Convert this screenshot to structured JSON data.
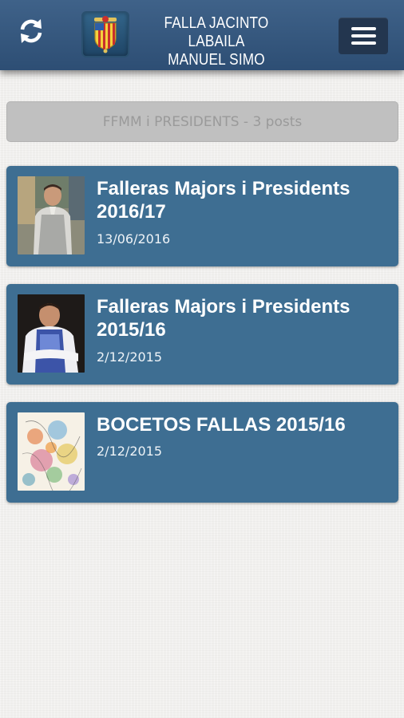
{
  "header": {
    "title_line1": "FALLA JACINTO LABAILA",
    "title_line2": "MANUEL SIMO",
    "refresh_icon": "refresh-icon",
    "menu_icon": "hamburger-menu-icon",
    "logo_icon": "falla-crest-logo"
  },
  "category": {
    "label": "FFMM i PRESIDENTS - 3 posts"
  },
  "posts": [
    {
      "title": "Falleras Majors i Presidents 2016/17",
      "date": "13/06/2016",
      "thumbnail": "photo-president-2016"
    },
    {
      "title": "Falleras Majors i Presidents 2015/16",
      "date": "2/12/2015",
      "thumbnail": "photo-president-2015"
    },
    {
      "title": "BOCETOS FALLAS 2015/16",
      "date": "2/12/2015",
      "thumbnail": "sketch-falla-2015"
    }
  ],
  "colors": {
    "header": "#2d4e74",
    "card": "#3e6e92",
    "menu_button": "#23364f",
    "category_bar": "#c0c0c0",
    "background": "#f1f0ee"
  }
}
